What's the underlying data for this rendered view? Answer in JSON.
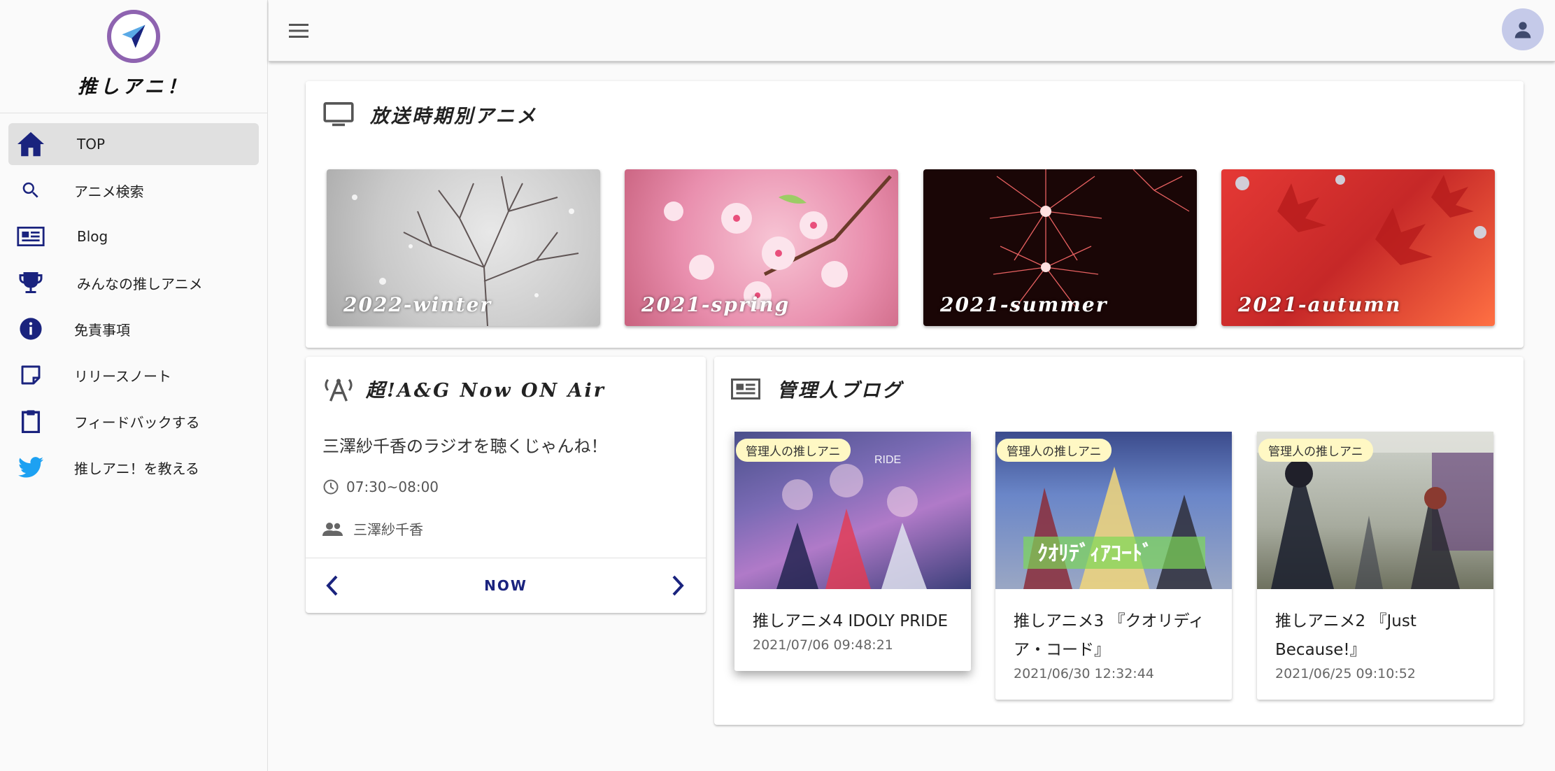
{
  "app": {
    "name": "推しアニ！"
  },
  "sidebar": {
    "items": [
      {
        "label": "TOP",
        "icon": "home-icon"
      },
      {
        "label": "アニメ検索",
        "icon": "search-icon"
      },
      {
        "label": "Blog",
        "icon": "newspaper-icon"
      },
      {
        "label": "みんなの推しアニメ",
        "icon": "trophy-icon"
      },
      {
        "label": "免責事項",
        "icon": "info-icon"
      },
      {
        "label": "リリースノート",
        "icon": "note-icon"
      },
      {
        "label": "フィードバックする",
        "icon": "clipboard-icon"
      },
      {
        "label": "推しアニ！を教える",
        "icon": "twitter-icon"
      }
    ]
  },
  "seasons": {
    "title": "放送時期別アニメ",
    "tiles": [
      {
        "label": "2022-winter"
      },
      {
        "label": "2021-spring"
      },
      {
        "label": "2021-summer"
      },
      {
        "label": "2021-autumn"
      }
    ]
  },
  "radio": {
    "title": "超!A&G Now ON Air",
    "program": "三澤紗千香のラジオを聴くじゃんね！",
    "time": "07:30~08:00",
    "personality": "三澤紗千香",
    "now_label": "NOW"
  },
  "blog": {
    "title": "管理人ブログ",
    "items": [
      {
        "chip": "管理人の推しアニ",
        "title": "推しアニメ4 IDOLY PRIDE",
        "date": "2021/07/06 09:48:21"
      },
      {
        "chip": "管理人の推しアニ",
        "title": "推しアニメ3 『クオリディア・コード』",
        "date": "2021/06/30 12:32:44"
      },
      {
        "chip": "管理人の推しアニ",
        "title": "推しアニメ2 『Just Because!』",
        "date": "2021/06/25 09:10:52"
      }
    ]
  },
  "colors": {
    "accent": "#1a237e",
    "logo_ring": "#8e63b0",
    "avatar_bg": "#c5cae9",
    "chip_bg": "#fff8c4"
  }
}
